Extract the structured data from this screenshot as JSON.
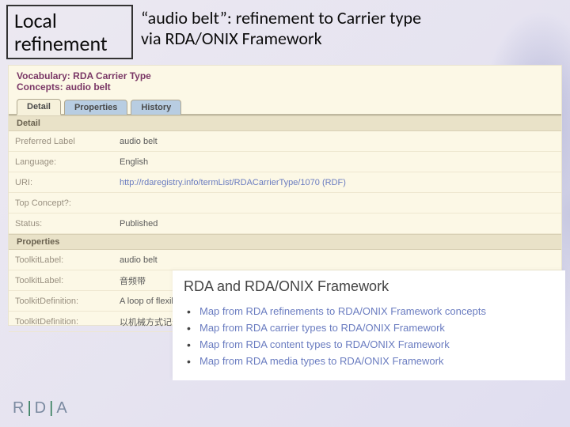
{
  "header": {
    "title_box_line1": "Local",
    "title_box_line2": "refinement",
    "subtitle_line1": "“audio belt”: refinement to Carrier type",
    "subtitle_line2": "via RDA/ONIX Framework"
  },
  "panel": {
    "vocab_label": "Vocabulary:",
    "vocab_value": "RDA Carrier Type",
    "concepts_label": "Concepts:",
    "concepts_value": "audio belt",
    "tabs": {
      "detail": "Detail",
      "properties": "Properties",
      "history": "History"
    },
    "sections": {
      "detail": "Detail",
      "properties": "Properties"
    },
    "rows": {
      "preferred_label": {
        "label": "Preferred Label",
        "value": "audio belt"
      },
      "language": {
        "label": "Language:",
        "value": "English"
      },
      "uri": {
        "label": "URI:",
        "value": "http://rdaregistry.info/termList/RDACarrierType/1070 (RDF)"
      },
      "top_concept": {
        "label": "Top Concept?:",
        "value": ""
      },
      "status": {
        "label": "Status:",
        "value": "Published"
      },
      "toolkit_label_1": {
        "label": "ToolkitLabel:",
        "value": "audio belt"
      },
      "toolkit_label_2": {
        "label": "ToolkitLabel:",
        "value": "音频带"
      },
      "toolkit_def_1": {
        "label": "ToolkitDefinition:",
        "value": "A loop of flexible pla"
      },
      "toolkit_def_2": {
        "label": "ToolkitDefinition:",
        "value": "以机械方式记录音频"
      }
    }
  },
  "overlay": {
    "title": "RDA and RDA/ONIX Framework",
    "items": [
      "Map from RDA refinements to RDA/ONIX Framework concepts",
      "Map from RDA carrier types to RDA/ONIX Framework",
      "Map from RDA content types to RDA/ONIX Framework",
      "Map from RDA media types to RDA/ONIX Framework"
    ]
  },
  "logo": {
    "r": "R",
    "d": "D",
    "a": "A"
  }
}
